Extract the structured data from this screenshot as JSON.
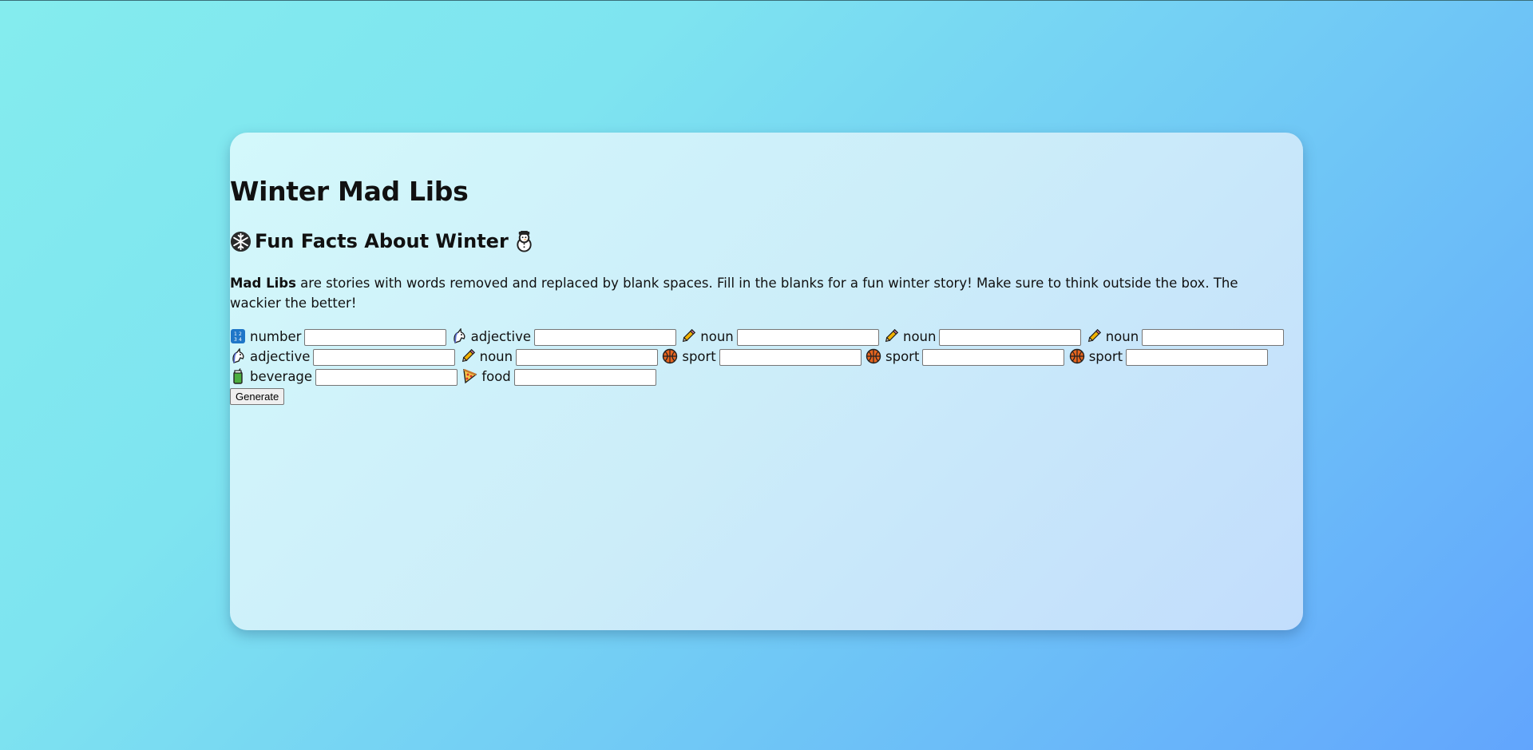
{
  "page": {
    "title": "Winter Mad Libs",
    "subtitle": "Fun Facts About Winter",
    "subtitle_icons": [
      "snowflake-icon",
      "snowman-icon"
    ],
    "intro": {
      "bold": "Mad Libs",
      "text": " are stories with words removed and replaced by blank spaces. Fill in the blanks for a fun winter story! Make sure to think outside the box. The wackier the better!"
    }
  },
  "fields": [
    {
      "label": "number",
      "icon": "numbers-icon",
      "value": ""
    },
    {
      "label": "adjective",
      "icon": "unicorn-icon",
      "value": ""
    },
    {
      "label": "noun",
      "icon": "pencil-icon",
      "value": ""
    },
    {
      "label": "noun",
      "icon": "pencil-icon",
      "value": ""
    },
    {
      "label": "noun",
      "icon": "pencil-icon",
      "value": ""
    },
    {
      "label": "adjective",
      "icon": "unicorn-icon",
      "value": ""
    },
    {
      "label": "noun",
      "icon": "pencil-icon",
      "value": ""
    },
    {
      "label": "sport",
      "icon": "basketball-icon",
      "value": ""
    },
    {
      "label": "sport",
      "icon": "basketball-icon",
      "value": ""
    },
    {
      "label": "sport",
      "icon": "basketball-icon",
      "value": ""
    },
    {
      "label": "beverage",
      "icon": "beverage-icon",
      "value": ""
    },
    {
      "label": "food",
      "icon": "pizza-icon",
      "value": ""
    }
  ],
  "actions": {
    "generate_label": "Generate"
  }
}
